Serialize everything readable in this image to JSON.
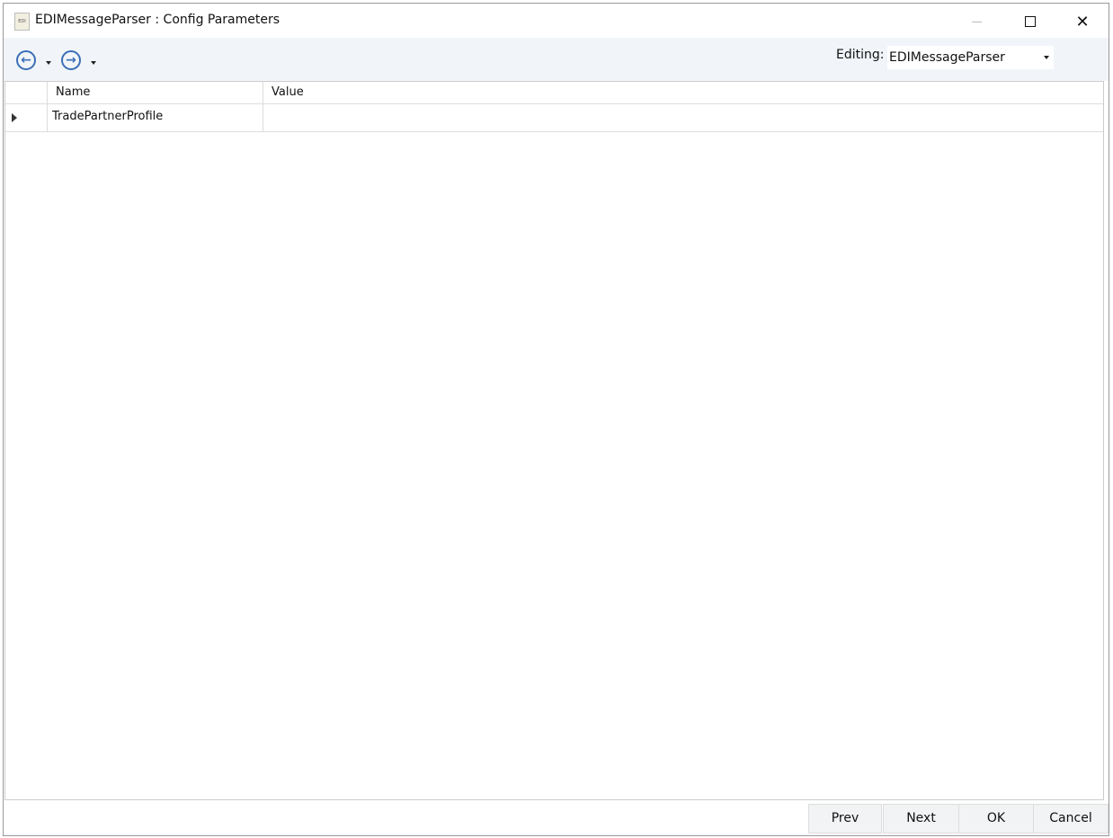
{
  "window": {
    "title": "EDIMessageParser : Config Parameters",
    "icon": "edi-file-icon",
    "icon_text": "EDI"
  },
  "toolbar": {
    "back": "arrow-left-circle-icon",
    "forward": "arrow-right-circle-icon",
    "editing_label": "Editing:",
    "editing_value": "EDIMessageParser"
  },
  "grid": {
    "columns": [
      "",
      "Name",
      "Value"
    ],
    "rows": [
      {
        "name": "TradePartnerProfile",
        "value": ""
      }
    ]
  },
  "footer": {
    "prev": "Prev",
    "next": "Next",
    "ok": "OK",
    "cancel": "Cancel"
  }
}
